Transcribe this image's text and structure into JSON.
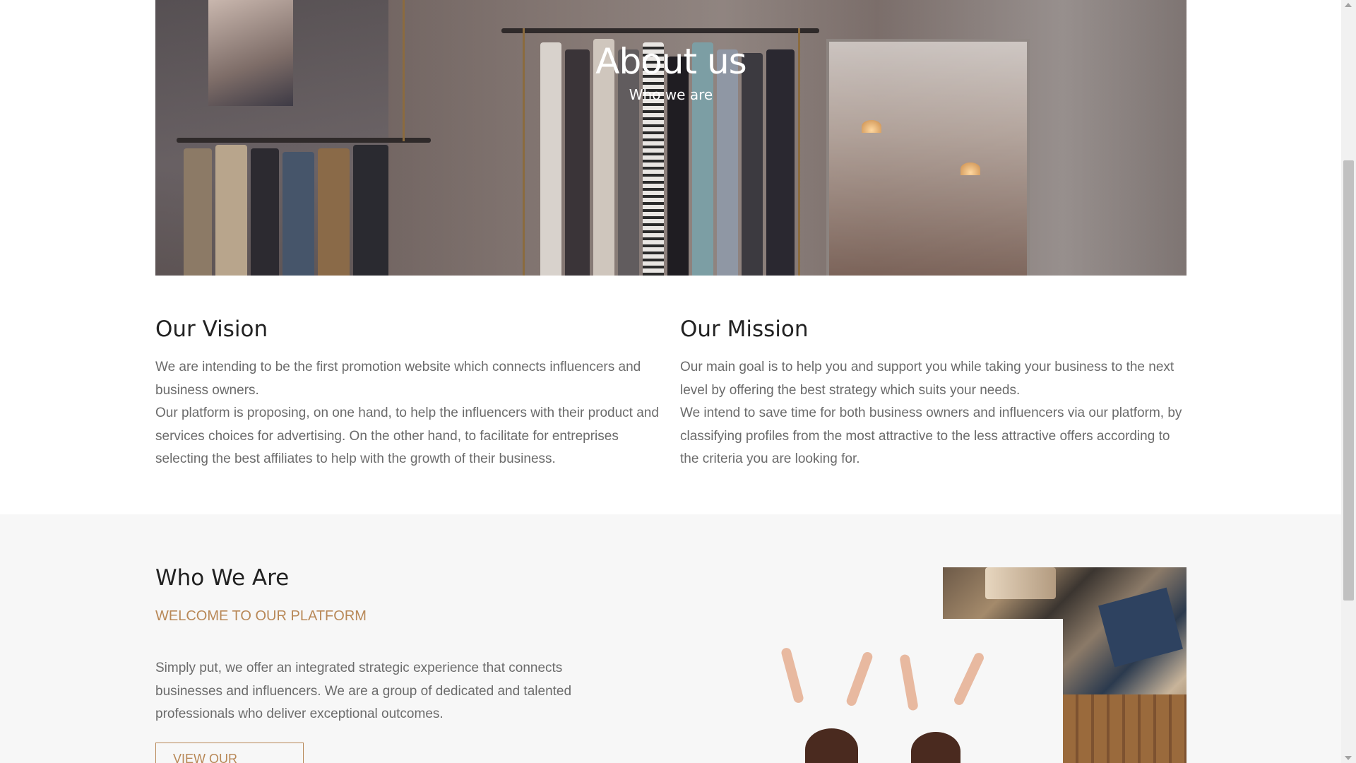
{
  "hero": {
    "title": "About us",
    "subtitle": "Who we are"
  },
  "vision": {
    "heading": "Our Vision",
    "paragraph_1": "We are intending to be the first promotion website which connects influencers and business owners.",
    "paragraph_2": "Our platform is proposing, on one hand, to help the influencers with their product and services choices for advertising. On the other hand, to facilitate for entreprises selecting the best affiliates to help with the growth of their business."
  },
  "mission": {
    "heading": "Our Mission",
    "paragraph_1": "Our main goal is to help you and support you while taking your business to the next level by offering the best strategy which suits your needs.",
    "paragraph_2": "We intend to save time for both business owners and influencers via our platform, by classifying profiles from the most attractive to the less attractive offers according to the criteria you are looking for."
  },
  "who_we_are": {
    "heading": "Who We Are",
    "kicker": "WELCOME TO OUR PLATFORM",
    "description": "Simply put, we offer an integrated strategic experience that connects businesses and influencers. We are a group of dedicated and talented professionals who deliver exceptional outcomes.",
    "button_label": "VIEW OUR NEWS",
    "button_icon": "arrow-right-icon"
  },
  "colors": {
    "accent": "#b88857",
    "heading": "#222222",
    "body_text": "#6b6b6b",
    "section_bg": "#f7f7f7"
  }
}
